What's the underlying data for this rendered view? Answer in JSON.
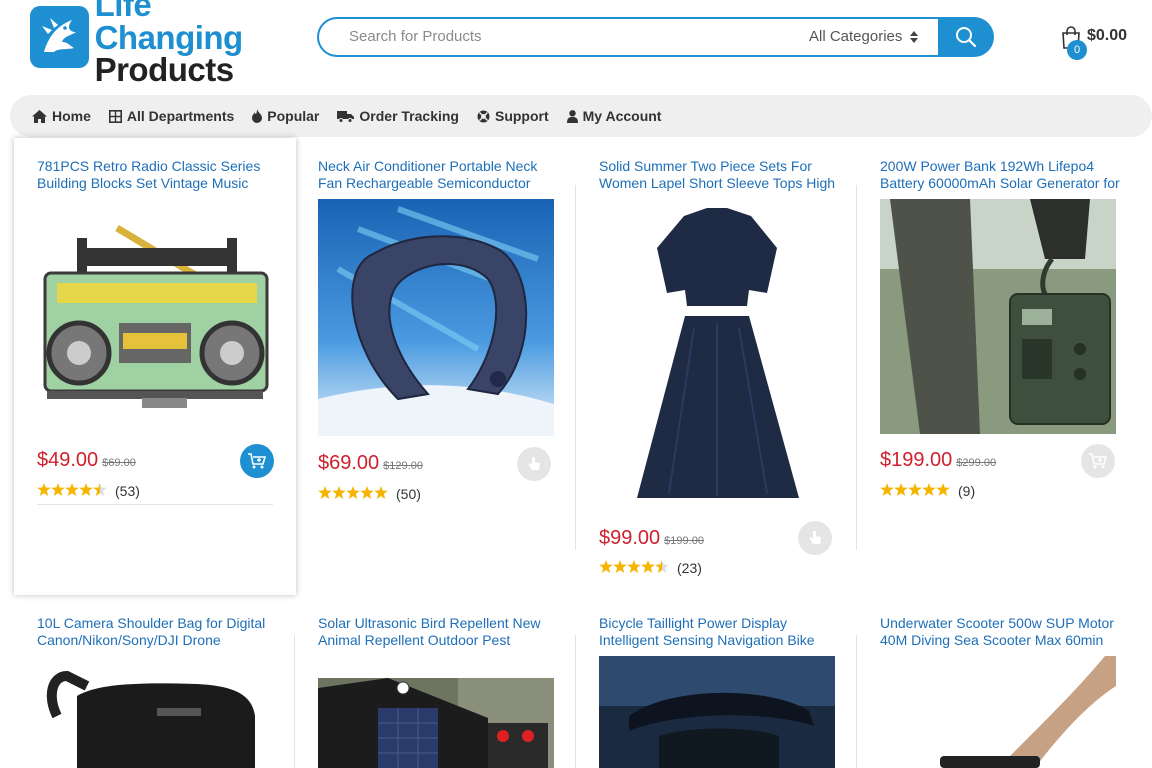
{
  "header": {
    "logo_line1": "Life Changing",
    "logo_line2": "Products",
    "search_placeholder": "Search for Products",
    "category_label": "All Categories",
    "cart_total": "$0.00",
    "cart_count": "0"
  },
  "nav": [
    {
      "label": "Home",
      "icon": "home-icon"
    },
    {
      "label": "All Departments",
      "icon": "grid-icon"
    },
    {
      "label": "Popular",
      "icon": "fire-icon"
    },
    {
      "label": "Order Tracking",
      "icon": "truck-icon"
    },
    {
      "label": "Support",
      "icon": "lifebuoy-icon"
    },
    {
      "label": "My Account",
      "icon": "user-icon"
    }
  ],
  "products": [
    {
      "title": "781PCS Retro Radio Classic Series Building Blocks Set Vintage Music",
      "price": "$49.00",
      "old_price": "$69.00",
      "rating": 4.5,
      "reviews": "(53)"
    },
    {
      "title": "Neck Air Conditioner Portable Neck Fan Rechargeable Semiconductor Cooling",
      "price": "$69.00",
      "old_price": "$129.00",
      "rating": 5,
      "reviews": "(50)"
    },
    {
      "title": "Solid Summer Two Piece Sets For Women Lapel Short Sleeve Tops High",
      "price": "$99.00",
      "old_price": "$199.00",
      "rating": 4.5,
      "reviews": "(23)"
    },
    {
      "title": "200W Power Bank 192Wh Lifepo4 Battery 60000mAh Solar Generator for",
      "price": "$199.00",
      "old_price": "$299.00",
      "rating": 5,
      "reviews": "(9)"
    },
    {
      "title": "10L Camera Shoulder Bag for Digital Canon/Nikon/Sony/DJI Drone"
    },
    {
      "title": "Solar Ultrasonic Bird Repellent New Animal Repellent Outdoor Pest Sensor"
    },
    {
      "title": "Bicycle Taillight Power Display Intelligent Sensing Navigation Bike Rear"
    },
    {
      "title": "Underwater Scooter 500w SUP Motor 40M Diving Sea Scooter Max 60min"
    }
  ],
  "colors": {
    "accent": "#1e8fd0",
    "price": "#d0202d",
    "star": "#f5b400",
    "link": "#1e6fb8"
  }
}
